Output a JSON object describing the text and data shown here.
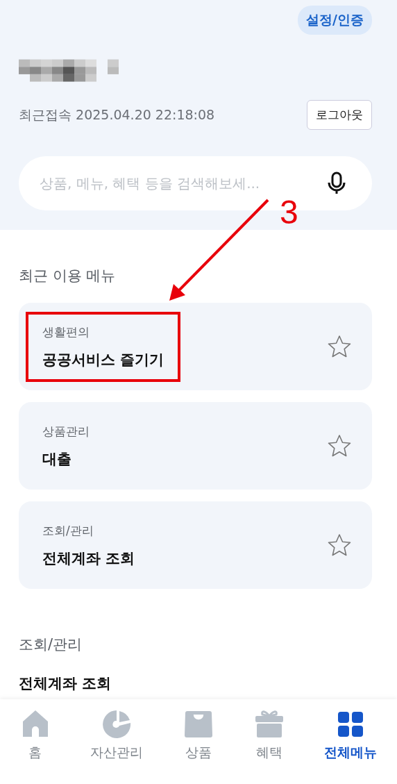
{
  "header": {
    "settings_badge": "설정/인증",
    "last_access_label": "최근접속",
    "last_access_time": "2025.04.20 22:18:08",
    "logout_button": "로그아웃"
  },
  "search": {
    "placeholder": "상품, 메뉴, 혜택 등을 검색해보세..."
  },
  "recent": {
    "title": "최근 이용 메뉴",
    "items": [
      {
        "category": "생활편의",
        "title": "공공서비스 즐기기",
        "favorite": false,
        "highlighted": true
      },
      {
        "category": "상품관리",
        "title": "대출",
        "favorite": false,
        "highlighted": false
      },
      {
        "category": "조회/관리",
        "title": "전체계좌 조회",
        "favorite": false,
        "highlighted": false
      }
    ]
  },
  "section": {
    "title": "조회/관리",
    "items": [
      "전체계좌 조회"
    ]
  },
  "annotation": {
    "label": "3"
  },
  "tab_bar": [
    {
      "kind": "home",
      "label": "홈",
      "selected": false
    },
    {
      "kind": "assets",
      "label": "자산관리",
      "selected": false
    },
    {
      "kind": "products",
      "label": "상품",
      "selected": false
    },
    {
      "kind": "benefits",
      "label": "혜택",
      "selected": false
    },
    {
      "kind": "menu",
      "label": "전체메뉴",
      "selected": true
    }
  ]
}
